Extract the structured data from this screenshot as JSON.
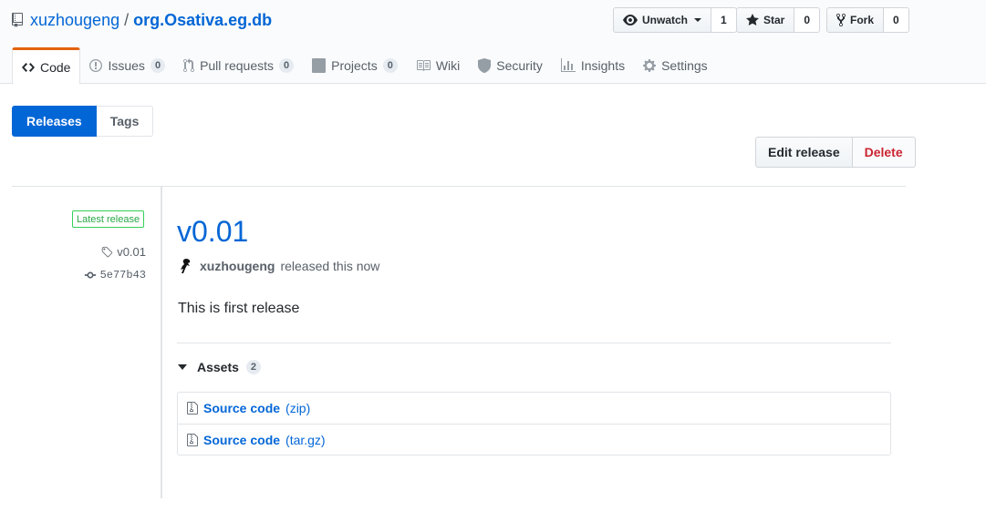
{
  "repo": {
    "owner": "xuzhougeng",
    "separator": "/",
    "name": "org.Osativa.eg.db"
  },
  "actions": {
    "watch": {
      "label": "Unwatch",
      "count": "1"
    },
    "star": {
      "label": "Star",
      "count": "0"
    },
    "fork": {
      "label": "Fork",
      "count": "0"
    }
  },
  "tabs": [
    {
      "label": "Code"
    },
    {
      "label": "Issues",
      "count": "0"
    },
    {
      "label": "Pull requests",
      "count": "0"
    },
    {
      "label": "Projects",
      "count": "0"
    },
    {
      "label": "Wiki"
    },
    {
      "label": "Security"
    },
    {
      "label": "Insights"
    },
    {
      "label": "Settings"
    }
  ],
  "subnav": {
    "releases": "Releases",
    "tags": "Tags"
  },
  "release_actions": {
    "edit": "Edit release",
    "delete": "Delete"
  },
  "release": {
    "badge": "Latest release",
    "tag": "v0.01",
    "commit": "5e77b43",
    "title": "v0.01",
    "author": "xuzhougeng",
    "released_text": "released this now",
    "description": "This is first release",
    "assets_label": "Assets",
    "assets_count": "2",
    "assets": [
      {
        "name": "Source code",
        "ext": "(zip)"
      },
      {
        "name": "Source code",
        "ext": "(tar.gz)"
      }
    ]
  },
  "colors": {
    "accent": "#0366d6",
    "tab_active_border": "#e36209",
    "danger": "#cb2431",
    "badge_green": "#28a745"
  }
}
